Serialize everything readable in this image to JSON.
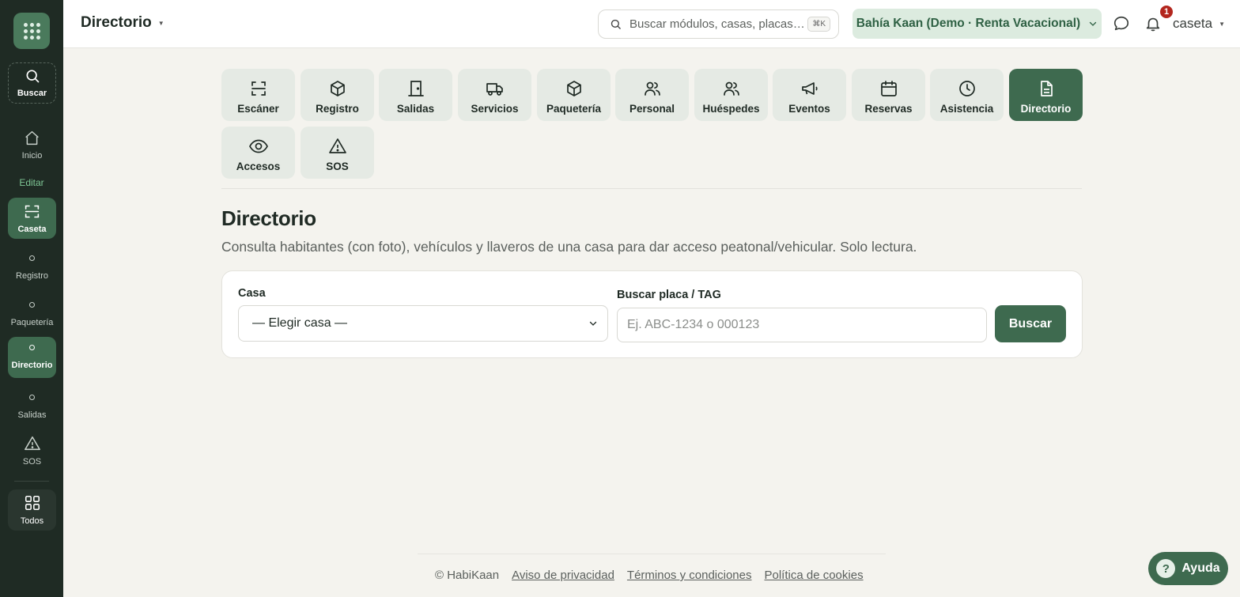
{
  "sidebar": {
    "search_label": "Buscar",
    "home_label": "Inicio",
    "section_label": "Editar",
    "caseta_label": "Caseta",
    "items": [
      {
        "label": "Registro"
      },
      {
        "label": "Paquetería"
      },
      {
        "label": "Directorio"
      },
      {
        "label": "Salidas"
      }
    ],
    "sos_label": "SOS",
    "all_label": "Todos"
  },
  "header": {
    "title": "Directorio",
    "search_placeholder": "Buscar módulos, casas, placas…",
    "search_shortcut": "⌘K",
    "property": "Bahía Kaan (Demo · Renta Vacacional)",
    "notifications_count": "1",
    "user": "caseta"
  },
  "modules": [
    {
      "label": "Escáner",
      "icon": "scan-icon"
    },
    {
      "label": "Registro",
      "icon": "box-icon"
    },
    {
      "label": "Salidas",
      "icon": "door-icon"
    },
    {
      "label": "Servicios",
      "icon": "truck-icon"
    },
    {
      "label": "Paquetería",
      "icon": "box-icon"
    },
    {
      "label": "Personal",
      "icon": "users-icon"
    },
    {
      "label": "Huéspedes",
      "icon": "users-icon"
    },
    {
      "label": "Eventos",
      "icon": "megaphone-icon"
    },
    {
      "label": "Reservas",
      "icon": "calendar-icon"
    },
    {
      "label": "Asistencia",
      "icon": "clock-icon"
    },
    {
      "label": "Directorio",
      "icon": "document-icon"
    },
    {
      "label": "Accesos",
      "icon": "eye-icon"
    },
    {
      "label": "SOS",
      "icon": "warning-icon"
    }
  ],
  "main": {
    "title": "Directorio",
    "subtitle": "Consulta habitantes (con foto), vehículos y llaveros de una casa para dar acceso peatonal/vehicular. Solo lectura.",
    "casa_label": "Casa",
    "casa_value": "— Elegir casa —",
    "plate_label": "Buscar placa / TAG",
    "plate_placeholder": "Ej. ABC-1234 o 000123",
    "search_button": "Buscar"
  },
  "footer": {
    "copyright": "© HabiKaan",
    "privacy": "Aviso de privacidad",
    "terms": "Términos y condiciones",
    "cookies": "Política de cookies"
  },
  "help_label": "Ayuda",
  "colors": {
    "accent": "#3e6a4f",
    "sidebar": "#1f2b24",
    "background": "#f4f3ee"
  }
}
